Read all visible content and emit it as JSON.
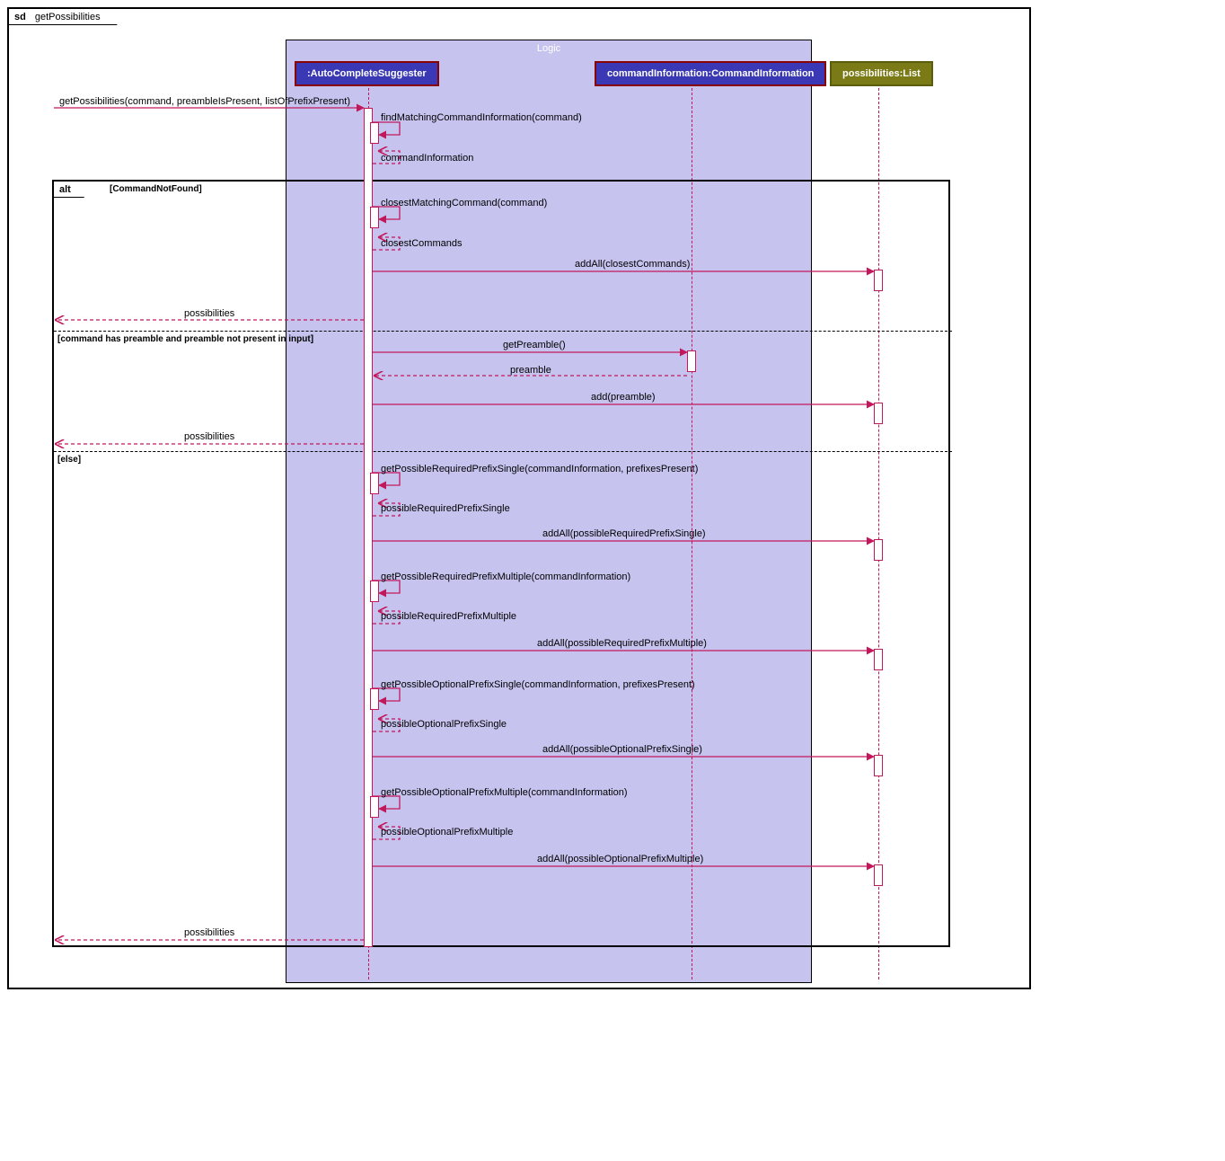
{
  "frame": {
    "sd": "sd",
    "title": "getPossibilities"
  },
  "logic": {
    "title": "Logic"
  },
  "participants": {
    "suggester": ":AutoCompleteSuggester",
    "cmdInfo": "commandInformation:CommandInformation",
    "possibilities": "possibilities:List"
  },
  "alt": {
    "label": "alt",
    "guards": {
      "g1": "[CommandNotFound]",
      "g2": "[command has preamble and preamble not present in input]",
      "g3": "[else]"
    }
  },
  "messages": {
    "m1": "getPossibilities(command, preambleIsPresent, listOfPrefixPresent)",
    "m2": "findMatchingCommandInformation(command)",
    "m3": "commandInformation",
    "m4": "closestMatchingCommand(command)",
    "m5": "closestCommands",
    "m6": "addAll(closestCommands)",
    "m7": "possibilities",
    "m8": "getPreamble()",
    "m9": "preamble",
    "m10": "add(preamble)",
    "m11": "possibilities",
    "m12": "getPossibleRequiredPrefixSingle(commandInformation, prefixesPresent)",
    "m13": "possibleRequiredPrefixSingle",
    "m14": "addAll(possibleRequiredPrefixSingle)",
    "m15": "getPossibleRequiredPrefixMultiple(commandInformation)",
    "m16": "possibleRequiredPrefixMultiple",
    "m17": "addAll(possibleRequiredPrefixMultiple)",
    "m18": "getPossibleOptionalPrefixSingle(commandInformation, prefixesPresent)",
    "m19": "possibleOptionalPrefixSingle",
    "m20": "addAll(possibleOptionalPrefixSingle)",
    "m21": "getPossibleOptionalPrefixMultiple(commandInformation)",
    "m22": "possibleOptionalPrefixMultiple",
    "m23": "addAll(possibleOptionalPrefixMultiple)",
    "m24": "possibilities"
  },
  "colors": {
    "line": "#c2185b",
    "blue": "#3a38b4",
    "olive": "#7a7a16"
  }
}
